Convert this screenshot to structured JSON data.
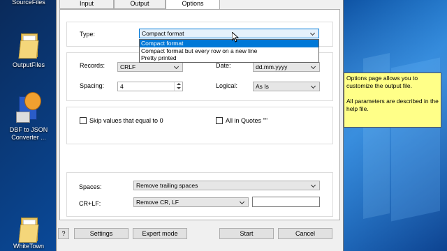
{
  "desktop": {
    "icons": [
      {
        "label": "SourceFiles"
      },
      {
        "label": "OutputFiles"
      },
      {
        "label": "DBF to JSON Converter ..."
      },
      {
        "label": "WhiteTown"
      }
    ]
  },
  "dialog": {
    "tabs": [
      {
        "label": "Input"
      },
      {
        "label": "Output"
      },
      {
        "label": "Options"
      }
    ],
    "type": {
      "label": "Type:",
      "value": "Compact format",
      "options": [
        "Compact format",
        "Compact format but every row on a new line",
        "Pretty printed"
      ]
    },
    "records": {
      "label": "Records:",
      "value": "CRLF"
    },
    "date": {
      "label": "Date:",
      "value": "dd.mm.yyyy"
    },
    "spacing": {
      "label": "Spacing:",
      "value": "4"
    },
    "logical": {
      "label": "Logical:",
      "value": "As Is"
    },
    "skip_zero": {
      "label": "Skip values that equal to 0",
      "checked": false
    },
    "all_in_quotes": {
      "label": "All in Quotes \"\"",
      "checked": false
    },
    "spaces": {
      "label": "Spaces:",
      "value": "Remove trailing spaces"
    },
    "crlf": {
      "label": "CR+LF:",
      "value": "Remove CR, LF",
      "text": ""
    },
    "buttons": {
      "help": "?",
      "settings": "Settings",
      "expert": "Expert mode",
      "start": "Start",
      "cancel": "Cancel"
    }
  },
  "note": {
    "line1": "Options page allows you to customize the output file.",
    "line2": "All parameters are described in the help file."
  }
}
